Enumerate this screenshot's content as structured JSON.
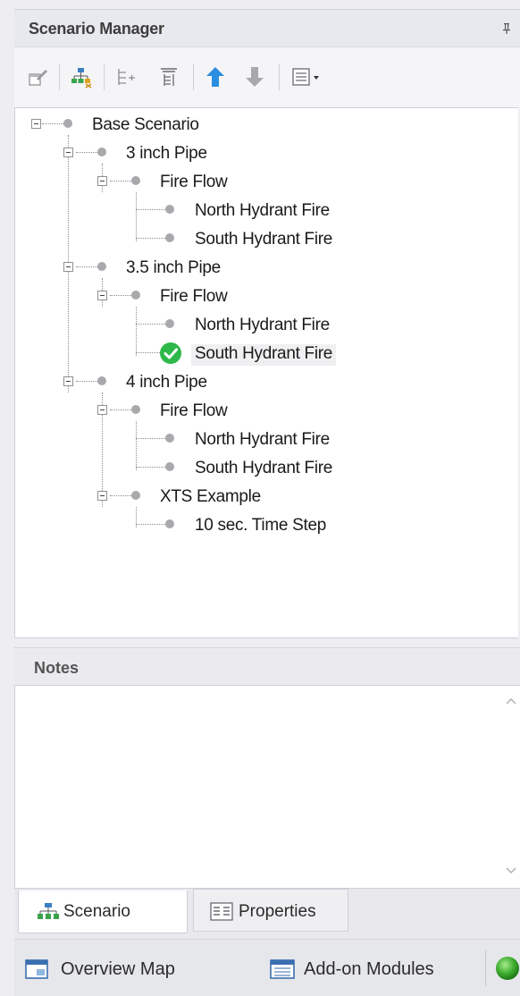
{
  "panel": {
    "title": "Scenario Manager"
  },
  "toolbar": {
    "buttons": [
      {
        "icon": "edit-scenario-icon"
      },
      {
        "icon": "create-child-scenario-icon"
      },
      {
        "icon": "collapse-tree-icon"
      },
      {
        "icon": "filter-tree-icon"
      },
      {
        "icon": "move-up-arrow-icon",
        "color": "#2b8ee0"
      },
      {
        "icon": "move-down-arrow-icon",
        "color": "#a9a9ad"
      },
      {
        "icon": "view-options-dropdown-icon"
      }
    ]
  },
  "tree": {
    "items": [
      {
        "label": "Base Scenario"
      },
      {
        "label": "3 inch Pipe"
      },
      {
        "label": "Fire Flow"
      },
      {
        "label": "North Hydrant Fire"
      },
      {
        "label": "South Hydrant Fire"
      },
      {
        "label": "3.5 inch Pipe"
      },
      {
        "label": "Fire Flow"
      },
      {
        "label": "North Hydrant Fire"
      },
      {
        "label": "South Hydrant Fire",
        "current": true
      },
      {
        "label": "4 inch Pipe"
      },
      {
        "label": "Fire Flow"
      },
      {
        "label": "North Hydrant Fire"
      },
      {
        "label": "South Hydrant Fire"
      },
      {
        "label": "XTS Example"
      },
      {
        "label": "10 sec. Time Step"
      }
    ],
    "current_color": "#2eb84a"
  },
  "notes": {
    "title": "Notes",
    "value": ""
  },
  "tabs": [
    {
      "label": "Scenario",
      "icon": "scenario-tree-icon",
      "active": true
    },
    {
      "label": "Properties",
      "icon": "properties-grid-icon",
      "active": false
    }
  ],
  "bottom_bar": {
    "items": [
      {
        "label": "Overview Map",
        "icon": "overview-map-icon"
      },
      {
        "label": "Add-on Modules",
        "icon": "add-on-modules-icon"
      }
    ],
    "status_color": "#3cab2e"
  }
}
